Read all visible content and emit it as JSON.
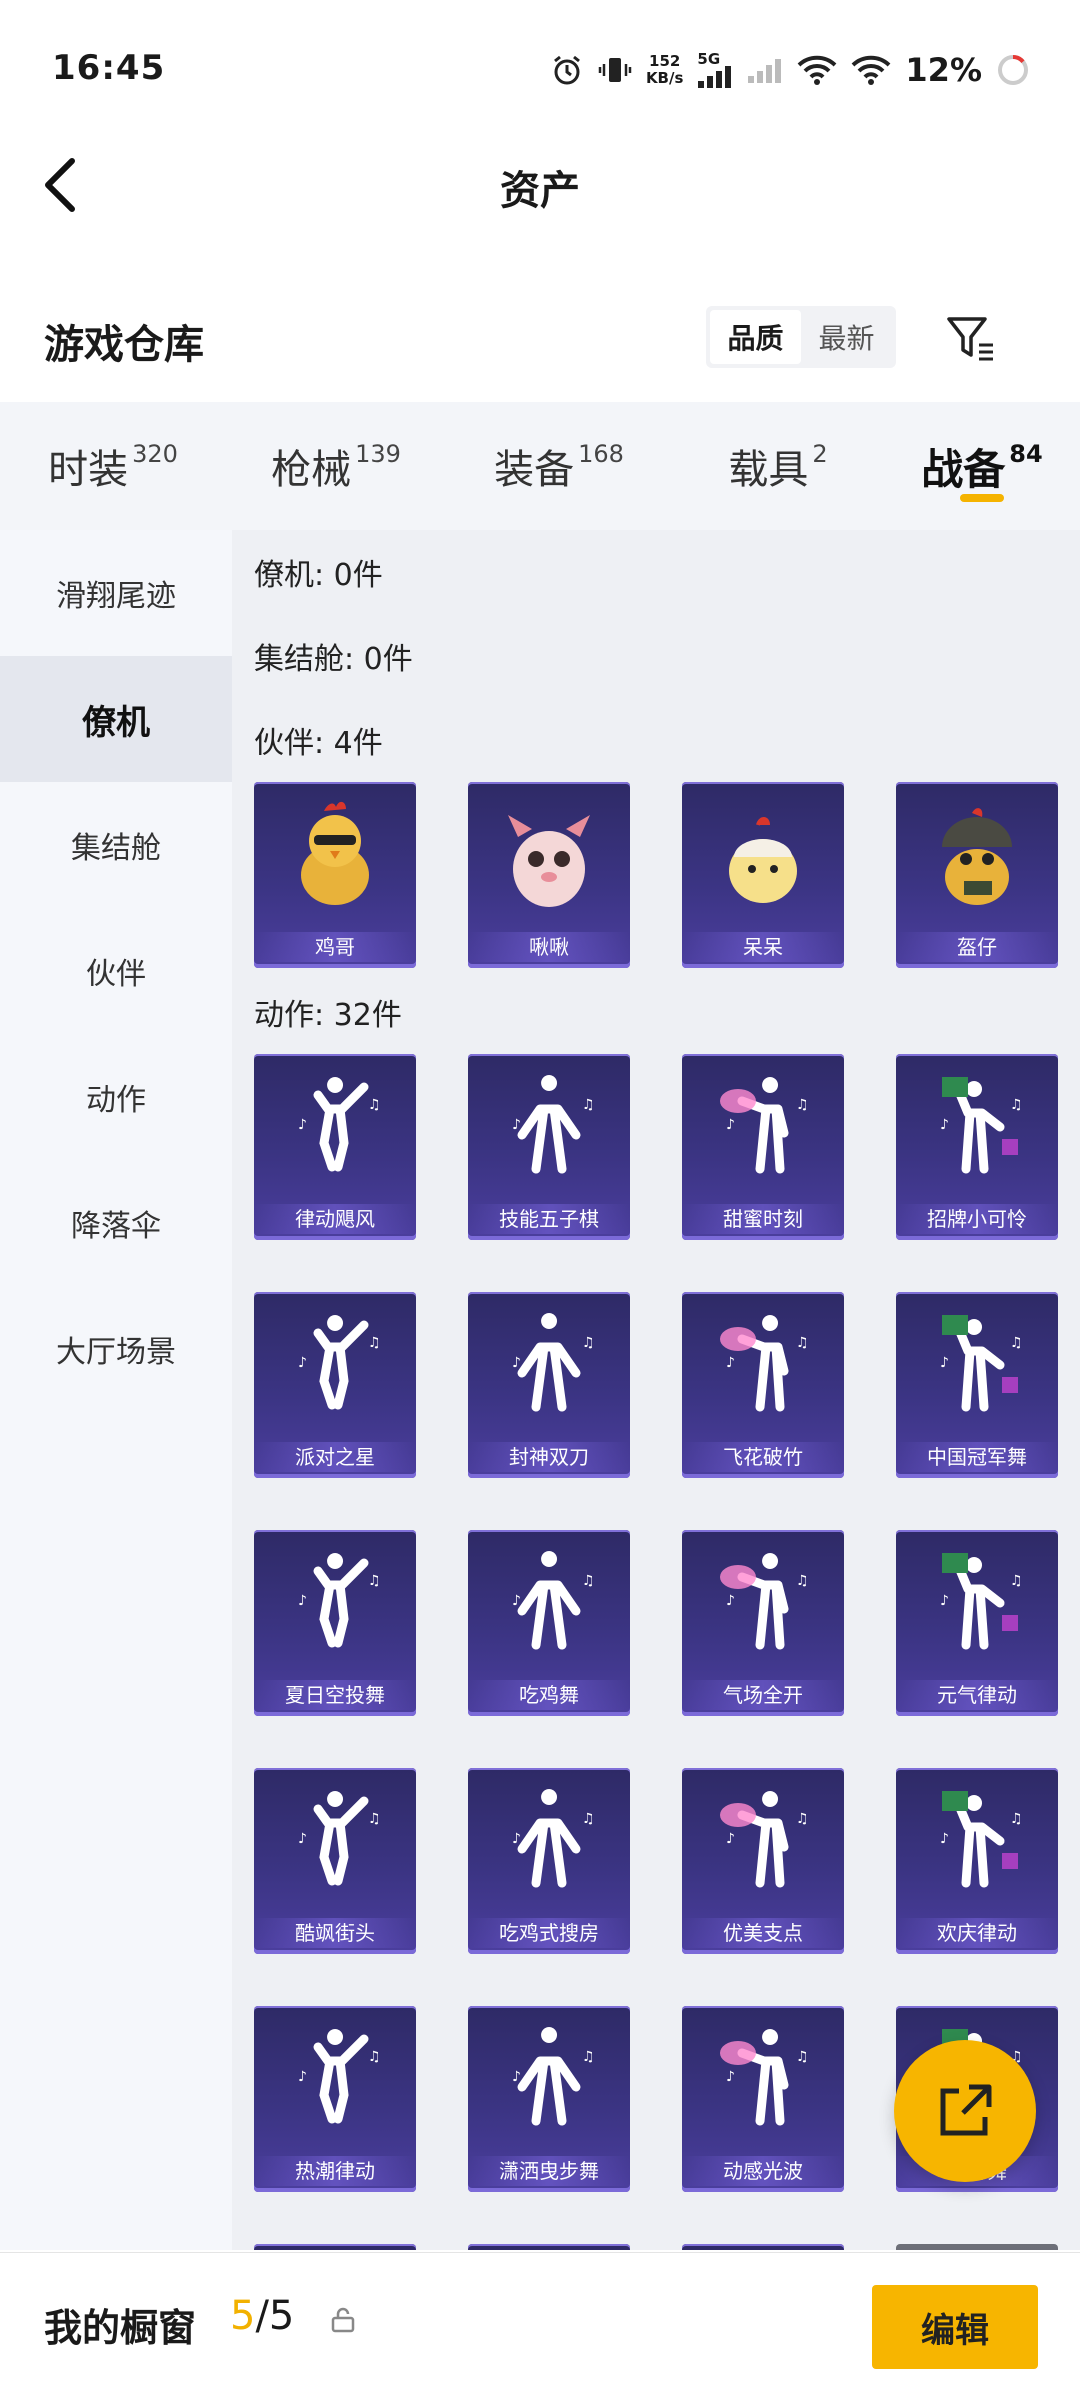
{
  "status_bar": {
    "time": "16:45",
    "net_speed_value": "152",
    "net_speed_unit": "KB/s",
    "network_type": "5G",
    "battery": "12%"
  },
  "header": {
    "title": "资产",
    "back_icon": "chevron-left-icon"
  },
  "section": {
    "title": "游戏仓库",
    "sort_options": [
      "品质",
      "最新"
    ],
    "sort_active": "品质",
    "filter_icon": "filter-icon"
  },
  "category_tabs": [
    {
      "label": "时装",
      "count": "320",
      "active": false
    },
    {
      "label": "枪械",
      "count": "139",
      "active": false
    },
    {
      "label": "装备",
      "count": "168",
      "active": false
    },
    {
      "label": "载具",
      "count": "2",
      "active": false
    },
    {
      "label": "战备",
      "count": "84",
      "active": true
    }
  ],
  "side_nav": [
    {
      "label": "滑翔尾迹",
      "active": false
    },
    {
      "label": "僚机",
      "active": true
    },
    {
      "label": "集结舱",
      "active": false
    },
    {
      "label": "伙伴",
      "active": false
    },
    {
      "label": "动作",
      "active": false
    },
    {
      "label": "降落伞",
      "active": false
    },
    {
      "label": "大厅场景",
      "active": false
    }
  ],
  "groups": {
    "wingman": "僚机: 0件",
    "pod": "集结舱: 0件",
    "partner": "伙伴: 4件",
    "emote": "动作: 32件"
  },
  "partners": [
    "鸡哥",
    "啾啾",
    "呆呆",
    "盔仔"
  ],
  "emotes": [
    "律动飓风",
    "技能五子棋",
    "甜蜜时刻",
    "招牌小可怜",
    "派对之星",
    "封神双刀",
    "飞花破竹",
    "中国冠军舞",
    "夏日空投舞",
    "吃鸡舞",
    "气场全开",
    "元气律动",
    "酷飒街头",
    "吃鸡式搜房",
    "优美支点",
    "欢庆律动",
    "热潮律动",
    "潇洒曳步舞",
    "动感光波",
    "燃力舞"
  ],
  "bottom_bar": {
    "label": "我的橱窗",
    "used": "5",
    "total": "/5",
    "edit_label": "编辑"
  },
  "colors": {
    "accent": "#f7b500",
    "card_bg": "#3b3483"
  }
}
